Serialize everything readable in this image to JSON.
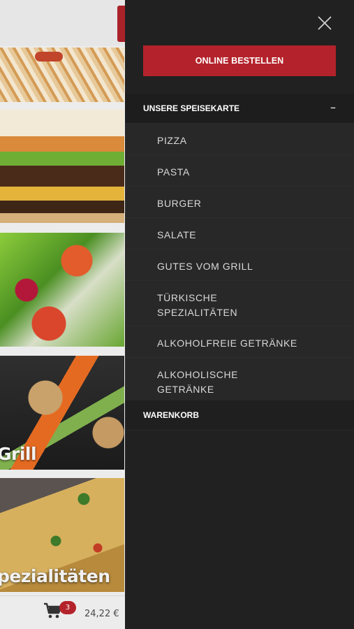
{
  "drawer": {
    "order_button": "ONLINE BESTELLEN",
    "menu_header": "UNSERE SPEISEKARTE",
    "menu_toggle": "–",
    "menu_items": [
      "PIZZA",
      "PASTA",
      "BURGER",
      "SALATE",
      "GUTES VOM GRILL",
      "TÜRKISCHE SPEZIALITÄTEN",
      "ALKOHOLFREIE GETRÄNKE",
      "ALKOHOLISCHE GETRÄNKE"
    ],
    "cart_link": "WARENKORB"
  },
  "background": {
    "tiles": {
      "grill_label": "Grill",
      "specialties_label": "pezialitäten"
    },
    "cart": {
      "count": "3",
      "total": "24,22 €"
    }
  },
  "colors": {
    "accent": "#b4232b",
    "drawer_bg": "#212121",
    "submenu_bg": "#282828"
  },
  "icons": {
    "close": "close-icon",
    "cart": "shopping-cart-icon"
  }
}
